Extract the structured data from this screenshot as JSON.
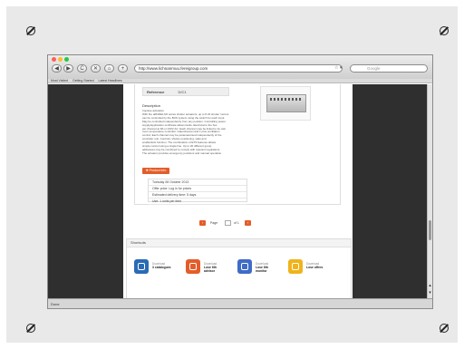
{
  "browser": {
    "url": "http://www.lichnanmuu.fereigroup.com",
    "search_placeholder": "Google",
    "nav": {
      "back": "◀",
      "forward": "▶",
      "reload": "C",
      "home": "⌂",
      "add": "+"
    },
    "url_controls": "☆ ▾",
    "bookmarks": [
      "Most Visited",
      "Getting Started",
      "Latest Headlines"
    ],
    "status": "Done",
    "traffic_lights": [
      "#ff5f57",
      "#febc2e",
      "#28c840"
    ]
  },
  "product": {
    "ref_label": "Reference",
    "ref_value": "D/C1",
    "description_heading": "Description",
    "description_lines": [
      "Impulse activation",
      "With the aiR2DELSO series shutter actuators, up to 8 24 shutter motors",
      "can be controlled by the BUS system using the switch for each input.",
      "May be controlled independently from any position. Controlling power",
      "supply/application certificate allows faults. Electrical to the bus",
      "per channel at 8A or 230V AC. Each channel may be linked to its own",
      "room temperature controller. Gate/channel and 1 plus ventilation",
      "control. Each channel may be parameterised independently of the",
      "controller unit. Controls: shutter positioning, slats and",
      "enable/lock function. The combination of ETS features allows",
      "simple control using a single line. Up to 20 different group",
      "addresses may be combined to comply with relevant regulations.",
      "The actuator provides emergency positions and manual operation."
    ],
    "button_label": "✚ Product info",
    "offer": {
      "date": "Tuesday 08 October 2013",
      "price": "Offer price:  Log in for prices",
      "delivery": "Estimated delivery time:  5 days",
      "stock": "Use:  1 units per item"
    }
  },
  "pager": {
    "page_label": "Page",
    "of_label": "of 1"
  },
  "shortcuts": {
    "title": "Shortcuts",
    "items": [
      {
        "label": "Download",
        "title": "3 catalogues",
        "color": "#2a6bb5"
      },
      {
        "label": "Download",
        "title": "Lose 6th",
        "sub": "advisor",
        "color": "#e35d2a"
      },
      {
        "label": "Download",
        "title": "Lose 6th",
        "sub": "monitor",
        "color": "#3f6cc6"
      },
      {
        "label": "Download",
        "title": "Lose offers",
        "color": "#f0b31c"
      }
    ]
  }
}
